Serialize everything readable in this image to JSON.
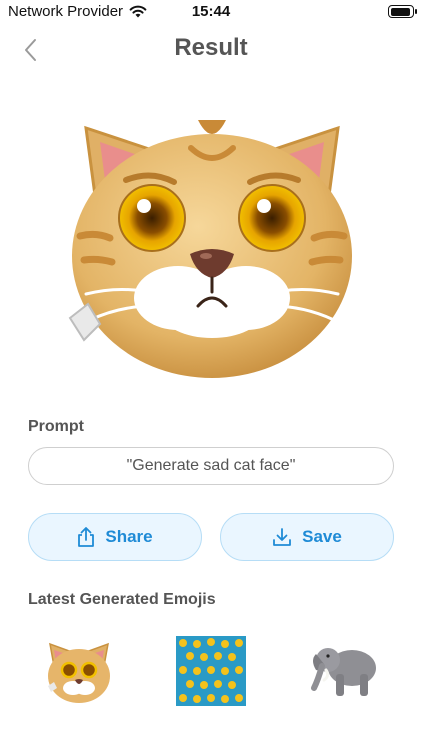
{
  "status": {
    "carrier": "Network Provider",
    "time": "15:44"
  },
  "nav": {
    "title": "Result"
  },
  "prompt": {
    "label": "Prompt",
    "value": "\"Generate sad cat face\""
  },
  "actions": {
    "share_label": "Share",
    "save_label": "Save"
  },
  "latest": {
    "label": "Latest Generated Emojis"
  },
  "colors": {
    "accent": "#1f8bd6",
    "button_bg": "#eaf6ff",
    "button_border": "#b6ddf6"
  },
  "icons": [
    "wifi-icon",
    "battery-icon",
    "back-chevron-icon",
    "share-icon",
    "download-icon"
  ]
}
